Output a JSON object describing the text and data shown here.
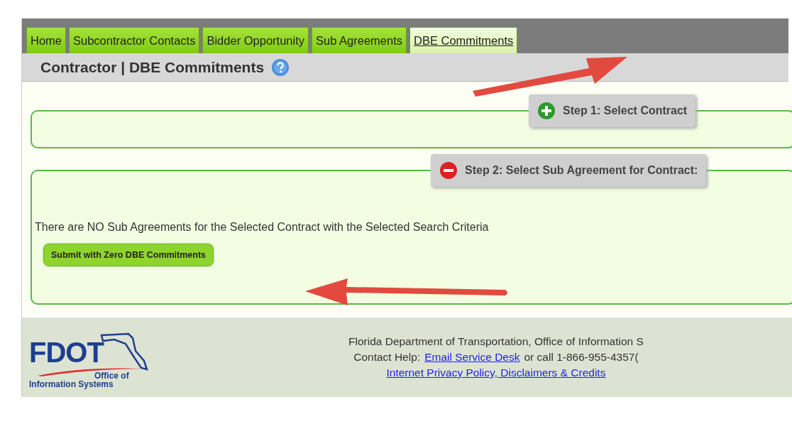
{
  "tabs": [
    {
      "label": "Home",
      "selected": false
    },
    {
      "label": "Subcontractor Contacts",
      "selected": false
    },
    {
      "label": "Bidder Opportunity",
      "selected": false
    },
    {
      "label": "Sub Agreements",
      "selected": false
    },
    {
      "label": "DBE Commitments",
      "selected": true
    }
  ],
  "page_title": "Contractor | DBE Commitments",
  "steps": [
    {
      "legend": "Step 1: Select Contract",
      "expanded": false
    },
    {
      "legend": "Step 2: Select Sub Agreement for Contract:",
      "expanded": true,
      "message": "There are NO Sub Agreements for the Selected Contract with the Selected Search Criteria",
      "button": "Submit with Zero DBE Commitments"
    }
  ],
  "footer": {
    "logo": {
      "name": "FDOT",
      "line_1": "Office of",
      "line_2": "Information Systems"
    },
    "line_1": "Florida Department of Transportation, Office of Information S",
    "contact_label": "Contact Help:",
    "contact_link": "Email Service Desk",
    "contact_rest": "or call 1-866-955-4357(",
    "policy_link": "Internet Privacy Policy, Disclaimers & Credits"
  }
}
